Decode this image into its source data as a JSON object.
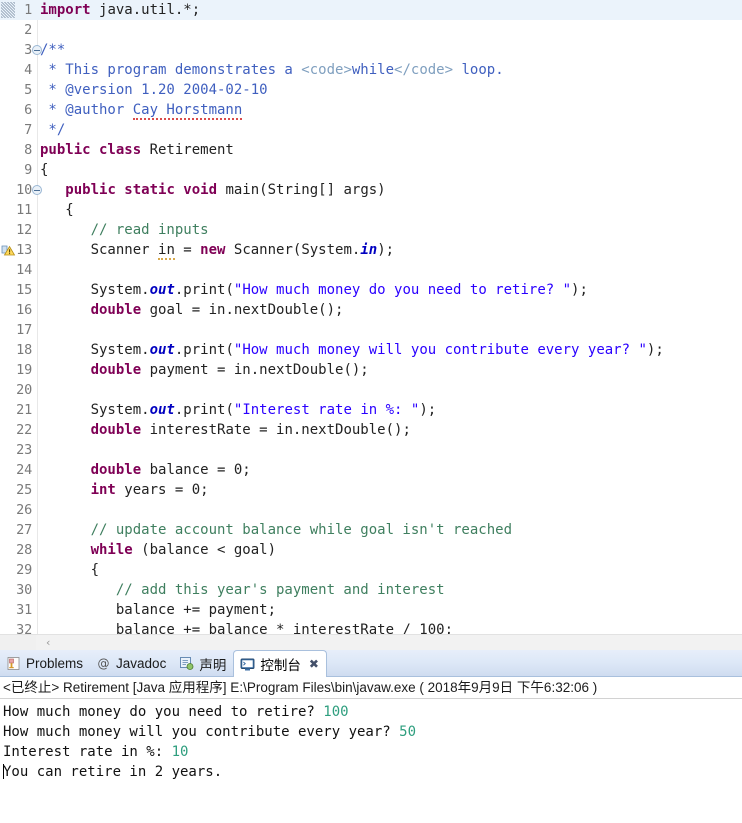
{
  "editor": {
    "name": "java-source-editor",
    "highlighted_line": 1,
    "lines": [
      {
        "n": "1",
        "marker": "change-bar",
        "fold": false,
        "tokens": [
          {
            "t": "import ",
            "c": "kw"
          },
          {
            "t": "java.util.*;",
            "c": "plain"
          }
        ]
      },
      {
        "n": "2",
        "marker": "",
        "fold": false,
        "tokens": []
      },
      {
        "n": "3",
        "marker": "",
        "fold": true,
        "tokens": [
          {
            "t": "/**",
            "c": "jdoc"
          }
        ]
      },
      {
        "n": "4",
        "marker": "",
        "fold": false,
        "tokens": [
          {
            "t": " * This program demonstrates a ",
            "c": "jdoc"
          },
          {
            "t": "<code>",
            "c": "jdoctag"
          },
          {
            "t": "while",
            "c": "jdoc"
          },
          {
            "t": "</code>",
            "c": "jdoctag"
          },
          {
            "t": " loop.",
            "c": "jdoc"
          }
        ]
      },
      {
        "n": "5",
        "marker": "",
        "fold": false,
        "tokens": [
          {
            "t": " * @version 1.20 2004-02-10",
            "c": "jdoc"
          }
        ]
      },
      {
        "n": "6",
        "marker": "",
        "fold": false,
        "tokens": [
          {
            "t": " * @author ",
            "c": "jdoc"
          },
          {
            "t": "Cay Horstmann",
            "c": "jdoc spell"
          }
        ]
      },
      {
        "n": "7",
        "marker": "",
        "fold": false,
        "tokens": [
          {
            "t": " */",
            "c": "jdoc"
          }
        ]
      },
      {
        "n": "8",
        "marker": "",
        "fold": false,
        "tokens": [
          {
            "t": "public class ",
            "c": "kw"
          },
          {
            "t": "Retirement",
            "c": "plain"
          }
        ]
      },
      {
        "n": "9",
        "marker": "",
        "fold": false,
        "tokens": [
          {
            "t": "{",
            "c": "plain"
          }
        ]
      },
      {
        "n": "10",
        "marker": "",
        "fold": true,
        "tokens": [
          {
            "t": "   ",
            "c": "plain"
          },
          {
            "t": "public static void ",
            "c": "kw"
          },
          {
            "t": "main(String[] args)",
            "c": "plain"
          }
        ]
      },
      {
        "n": "11",
        "marker": "",
        "fold": false,
        "tokens": [
          {
            "t": "   {",
            "c": "plain"
          }
        ]
      },
      {
        "n": "12",
        "marker": "",
        "fold": false,
        "tokens": [
          {
            "t": "      // read inputs",
            "c": "cmt"
          }
        ]
      },
      {
        "n": "13",
        "marker": "warning",
        "fold": false,
        "tokens": [
          {
            "t": "      Scanner ",
            "c": "plain"
          },
          {
            "t": "in",
            "c": "plain occur"
          },
          {
            "t": " = ",
            "c": "plain"
          },
          {
            "t": "new ",
            "c": "kw"
          },
          {
            "t": "Scanner(System.",
            "c": "plain"
          },
          {
            "t": "in",
            "c": "stfld"
          },
          {
            "t": ");",
            "c": "plain"
          }
        ]
      },
      {
        "n": "14",
        "marker": "",
        "fold": false,
        "tokens": []
      },
      {
        "n": "15",
        "marker": "",
        "fold": false,
        "tokens": [
          {
            "t": "      System.",
            "c": "plain"
          },
          {
            "t": "out",
            "c": "stfld"
          },
          {
            "t": ".print(",
            "c": "plain"
          },
          {
            "t": "\"How much money do you need to retire? \"",
            "c": "str"
          },
          {
            "t": ");",
            "c": "plain"
          }
        ]
      },
      {
        "n": "16",
        "marker": "",
        "fold": false,
        "tokens": [
          {
            "t": "      ",
            "c": "plain"
          },
          {
            "t": "double ",
            "c": "kw"
          },
          {
            "t": "goal = in.nextDouble();",
            "c": "plain"
          }
        ]
      },
      {
        "n": "17",
        "marker": "",
        "fold": false,
        "tokens": []
      },
      {
        "n": "18",
        "marker": "",
        "fold": false,
        "tokens": [
          {
            "t": "      System.",
            "c": "plain"
          },
          {
            "t": "out",
            "c": "stfld"
          },
          {
            "t": ".print(",
            "c": "plain"
          },
          {
            "t": "\"How much money will you contribute every year? \"",
            "c": "str"
          },
          {
            "t": ");",
            "c": "plain"
          }
        ]
      },
      {
        "n": "19",
        "marker": "",
        "fold": false,
        "tokens": [
          {
            "t": "      ",
            "c": "plain"
          },
          {
            "t": "double ",
            "c": "kw"
          },
          {
            "t": "payment = in.nextDouble();",
            "c": "plain"
          }
        ]
      },
      {
        "n": "20",
        "marker": "",
        "fold": false,
        "tokens": []
      },
      {
        "n": "21",
        "marker": "",
        "fold": false,
        "tokens": [
          {
            "t": "      System.",
            "c": "plain"
          },
          {
            "t": "out",
            "c": "stfld"
          },
          {
            "t": ".print(",
            "c": "plain"
          },
          {
            "t": "\"Interest rate in %: \"",
            "c": "str"
          },
          {
            "t": ");",
            "c": "plain"
          }
        ]
      },
      {
        "n": "22",
        "marker": "",
        "fold": false,
        "tokens": [
          {
            "t": "      ",
            "c": "plain"
          },
          {
            "t": "double ",
            "c": "kw"
          },
          {
            "t": "interestRate = in.nextDouble();",
            "c": "plain"
          }
        ]
      },
      {
        "n": "23",
        "marker": "",
        "fold": false,
        "tokens": []
      },
      {
        "n": "24",
        "marker": "",
        "fold": false,
        "tokens": [
          {
            "t": "      ",
            "c": "plain"
          },
          {
            "t": "double ",
            "c": "kw"
          },
          {
            "t": "balance = 0;",
            "c": "plain"
          }
        ]
      },
      {
        "n": "25",
        "marker": "",
        "fold": false,
        "tokens": [
          {
            "t": "      ",
            "c": "plain"
          },
          {
            "t": "int ",
            "c": "kw"
          },
          {
            "t": "years = 0;",
            "c": "plain"
          }
        ]
      },
      {
        "n": "26",
        "marker": "",
        "fold": false,
        "tokens": []
      },
      {
        "n": "27",
        "marker": "",
        "fold": false,
        "tokens": [
          {
            "t": "      // update account balance while goal isn't reached",
            "c": "cmt"
          }
        ]
      },
      {
        "n": "28",
        "marker": "",
        "fold": false,
        "tokens": [
          {
            "t": "      ",
            "c": "plain"
          },
          {
            "t": "while ",
            "c": "kw"
          },
          {
            "t": "(balance < goal)",
            "c": "plain"
          }
        ]
      },
      {
        "n": "29",
        "marker": "",
        "fold": false,
        "tokens": [
          {
            "t": "      {",
            "c": "plain"
          }
        ]
      },
      {
        "n": "30",
        "marker": "",
        "fold": false,
        "tokens": [
          {
            "t": "         // add this year's payment and interest",
            "c": "cmt"
          }
        ]
      },
      {
        "n": "31",
        "marker": "",
        "fold": false,
        "tokens": [
          {
            "t": "         balance += payment;",
            "c": "plain"
          }
        ]
      },
      {
        "n": "32",
        "marker": "",
        "fold": false,
        "tokens": [
          {
            "t": "         balance += balance * interestRate / 100;",
            "c": "plain"
          }
        ]
      }
    ],
    "hscroll": {
      "left_arrow": "‹"
    }
  },
  "panel": {
    "tabs": [
      {
        "label": "Problems",
        "icon": "problems-icon",
        "active": false,
        "closable": false
      },
      {
        "label": "Javadoc",
        "icon": "javadoc-at-icon",
        "active": false,
        "closable": false
      },
      {
        "label": "声明",
        "icon": "declaration-icon",
        "active": false,
        "closable": false
      },
      {
        "label": "控制台",
        "icon": "console-icon",
        "active": true,
        "closable": true,
        "close_label": "✖"
      }
    ],
    "console": {
      "header": "<已终止> Retirement [Java 应用程序] E:\\Program Files\\bin\\javaw.exe ( 2018年9月9日 下午6:32:06 )",
      "lines": [
        {
          "prompt": "How much money do you need to retire? ",
          "input": "100",
          "caret": false
        },
        {
          "prompt": "How much money will you contribute every year? ",
          "input": "50",
          "caret": false
        },
        {
          "prompt": "Interest rate in %: ",
          "input": "10",
          "caret": false
        },
        {
          "prompt": "You can retire in 2 years.",
          "input": "",
          "caret": true
        }
      ]
    }
  },
  "colors": {
    "keyword": "#7f0055",
    "string": "#2a00ff",
    "line_comment": "#3f7f5f",
    "javadoc": "#3f5fbf",
    "javadoc_tag": "#7f9fbf",
    "static_field": "#0000c0",
    "console_input": "#2e9e7e",
    "line_highlight": "#ebf3fb",
    "tabbar": "#dde8f7"
  }
}
